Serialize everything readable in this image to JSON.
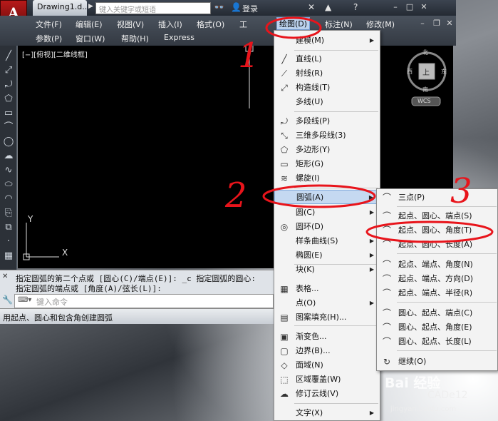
{
  "titlebar": {
    "app_letter": "A",
    "doc_tab": "Drawing1.d...",
    "search_placeholder": "键入关键字或短语",
    "login": "登录"
  },
  "menubar": {
    "row1": [
      "文件(F)",
      "编辑(E)",
      "视图(V)",
      "插入(I)",
      "格式(O)",
      "工",
      "绘图(D)",
      "标注(N)",
      "修改(M)"
    ],
    "row2": [
      "参数(P)",
      "窗口(W)",
      "帮助(H)",
      "Express"
    ]
  },
  "canvas": {
    "view_label": "[−][俯视][二维线框]",
    "ucs_y": "Y",
    "ucs_x": "X",
    "viewcube": {
      "north": "北",
      "south": "南",
      "west": "西",
      "east": "东",
      "top": "上",
      "wcs": "WCS"
    }
  },
  "command": {
    "line1": "指定圆弧的第二个点或 [圆心(C)/端点(E)]: _c 指定圆弧的圆心:",
    "line2": "指定圆弧的端点或 [角度(A)/弦长(L)]:",
    "input_placeholder": "键入命令"
  },
  "statusbar": {
    "text": "用起点、圆心和包含角创建圆弧"
  },
  "draw_menu": {
    "items": [
      {
        "label": "建模(M)",
        "icon": "",
        "submenu": true
      },
      {
        "label": "直线(L)",
        "icon": "line-icon"
      },
      {
        "label": "射线(R)",
        "icon": "ray-icon"
      },
      {
        "label": "构造线(T)",
        "icon": "xline-icon"
      },
      {
        "label": "多线(U)",
        "icon": "mline-icon"
      },
      {
        "label": "多段线(P)",
        "icon": "pline-icon"
      },
      {
        "label": "三维多段线(3)",
        "icon": "3dpoly-icon"
      },
      {
        "label": "多边形(Y)",
        "icon": "polygon-icon"
      },
      {
        "label": "矩形(G)",
        "icon": "rectangle-icon"
      },
      {
        "label": "螺旋(I)",
        "icon": "helix-icon"
      },
      {
        "label": "圆弧(A)",
        "icon": "",
        "submenu": true
      },
      {
        "label": "圆(C)",
        "icon": "",
        "submenu": true
      },
      {
        "label": "圆环(D)",
        "icon": "donut-icon"
      },
      {
        "label": "样条曲线(S)",
        "icon": "",
        "submenu": true
      },
      {
        "label": "椭圆(E)",
        "icon": "",
        "submenu": true
      },
      {
        "label": "块(K)",
        "icon": "",
        "submenu": true
      },
      {
        "label": "表格...",
        "icon": "table-icon"
      },
      {
        "label": "点(O)",
        "icon": "",
        "submenu": true
      },
      {
        "label": "图案填充(H)...",
        "icon": "hatch-icon"
      },
      {
        "label": "渐变色...",
        "icon": "gradient-icon"
      },
      {
        "label": "边界(B)...",
        "icon": "boundary-icon"
      },
      {
        "label": "面域(N)",
        "icon": "region-icon"
      },
      {
        "label": "区域覆盖(W)",
        "icon": "wipeout-icon"
      },
      {
        "label": "修订云线(V)",
        "icon": "revcloud-icon"
      },
      {
        "label": "文字(X)",
        "icon": "",
        "submenu": true
      }
    ]
  },
  "arc_submenu": {
    "items": [
      "三点(P)",
      "起点、圆心、端点(S)",
      "起点、圆心、角度(T)",
      "起点、圆心、长度(A)",
      "起点、端点、角度(N)",
      "起点、端点、方向(D)",
      "起点、端点、半径(R)",
      "圆心、起点、端点(C)",
      "圆心、起点、角度(E)",
      "圆心、起点、长度(L)",
      "继续(O)"
    ]
  },
  "annotations": {
    "n1": "1",
    "n2": "2",
    "n3": "3"
  },
  "watermark": {
    "logo": "Bai 经验",
    "account": "CADe12",
    "site": "jingyan.baidu.com"
  },
  "colors": {
    "marker": "#e8141b",
    "highlight": "#c5d9f1",
    "canvas": "#000000"
  }
}
